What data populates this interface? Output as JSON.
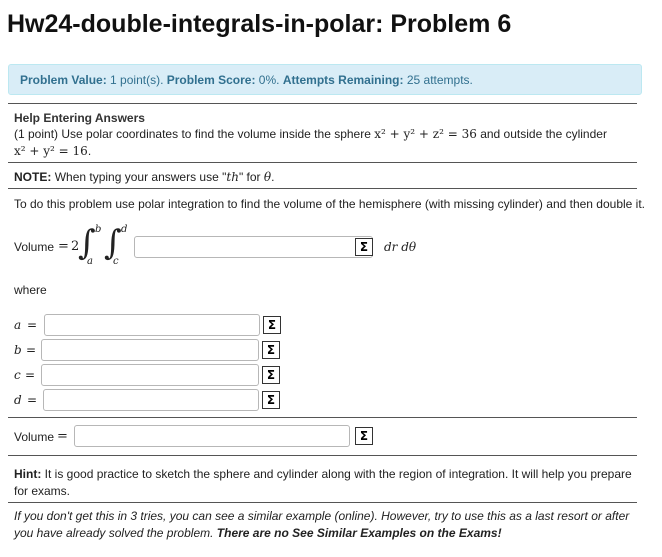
{
  "title": "Hw24-double-integrals-in-polar: Problem 6",
  "info": {
    "value_label": "Problem Value:",
    "value_text": "1 point(s).",
    "score_label": "Problem Score:",
    "score_text": "0%.",
    "attempts_label": "Attempts Remaining:",
    "attempts_text": "25 attempts."
  },
  "help_link": "Help Entering Answers",
  "problem": {
    "points": "(1 point)",
    "text_a": "Use polar coordinates to find the volume inside the sphere",
    "sphere_eq": "x² + y² + z² = 36",
    "text_b": "and outside the cylinder",
    "cylinder_eq": "x² + y² = 16",
    "period": "."
  },
  "note": {
    "label": "NOTE:",
    "text": "When typing your answers use \"th\" for θ.",
    "text_pre": "When typing your answers use \"",
    "th": "th",
    "text_mid": "\" for ",
    "theta": "θ",
    "text_end": "."
  },
  "instruction": "To do this problem use polar integration to find the volume of the hemisphere (with missing cylinder) and then double it.",
  "volume_integral": {
    "label": "Volume",
    "eq": "=",
    "coef": "2",
    "upper1": "b",
    "lower1": "a",
    "upper2": "d",
    "lower2": "c",
    "differentials": "dr dθ",
    "value": ""
  },
  "where_label": "where",
  "limits": [
    {
      "var": "a",
      "eq": "=",
      "value": ""
    },
    {
      "var": "b",
      "eq": "=",
      "value": ""
    },
    {
      "var": "c",
      "eq": "=",
      "value": ""
    },
    {
      "var": "d",
      "eq": "=",
      "value": ""
    }
  ],
  "volume_answer": {
    "label": "Volume",
    "eq": "=",
    "value": ""
  },
  "sigma_glyph": "Σ",
  "hint": {
    "label": "Hint:",
    "text": "It is good practice to sketch the sphere and cylinder along with the region of integration. It will help you prepare for exams."
  },
  "footer": {
    "text": "If you don't get this in 3 tries, you can see a similar example (online). However, try to use this as a last resort or after you have already solved the problem.",
    "bold": "There are no See Similar Examples on the Exams!"
  }
}
